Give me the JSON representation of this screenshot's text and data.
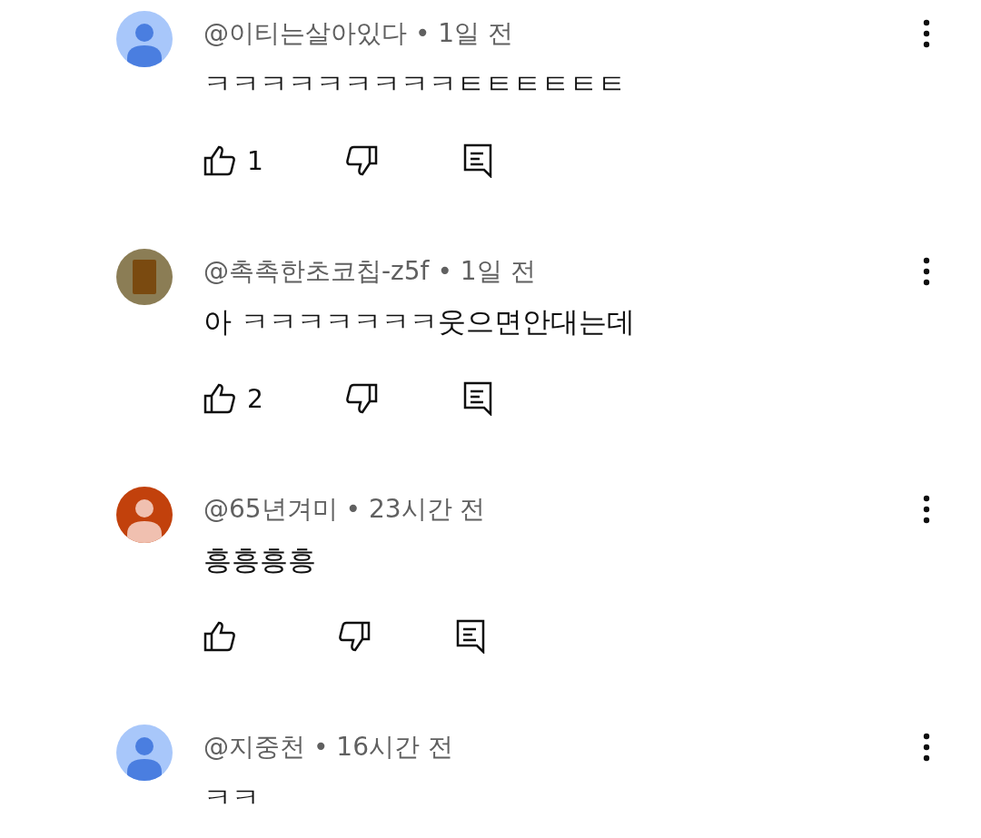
{
  "comments": [
    {
      "author": "@이티는살아있다",
      "separator": "•",
      "time": "1일 전",
      "text": "ㅋㅋㅋㅋㅋㅋㅋㅋㅋㅌㅌㅌㅌㅌㅌ",
      "avatar": {
        "kind": "silhouette",
        "color": "#a8c7fa"
      },
      "likes": "1",
      "actions_shown": true
    },
    {
      "author": "@촉촉한초코칩-z5f",
      "separator": "•",
      "time": "1일 전",
      "text": "아 ㅋㅋㅋㅋㅋㅋㅋ웃으면안대는데",
      "avatar": {
        "kind": "photo",
        "color": "#8b7d55"
      },
      "likes": "2",
      "actions_shown": true
    },
    {
      "author": "@65년겨미",
      "separator": "•",
      "time": "23시간 전",
      "text": "흥흥흥흥",
      "avatar": {
        "kind": "silhouette",
        "color": "#c2410c"
      },
      "actions_shown": true
    },
    {
      "author": "@지중천",
      "separator": "•",
      "time": "16시간 전",
      "text": "ㅋㅋ",
      "avatar": {
        "kind": "silhouette",
        "color": "#a8c7fa"
      },
      "actions_shown": false
    }
  ]
}
